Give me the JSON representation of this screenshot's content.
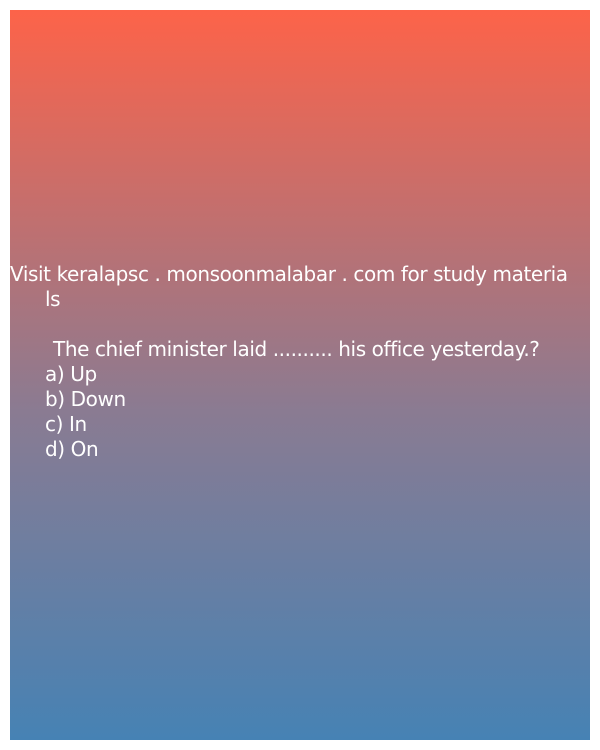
{
  "card": {
    "promo_line1": "Visit keralapsc . monsoonmalabar . com for study materia",
    "promo_line2": "ls",
    "question": "The chief minister laid .......... his office yesterday.?",
    "options": [
      "a) Up",
      "b) Down",
      "c) In",
      "d) On"
    ],
    "gradient": {
      "top": "#fd6349",
      "bottom": "#4682b4"
    }
  }
}
